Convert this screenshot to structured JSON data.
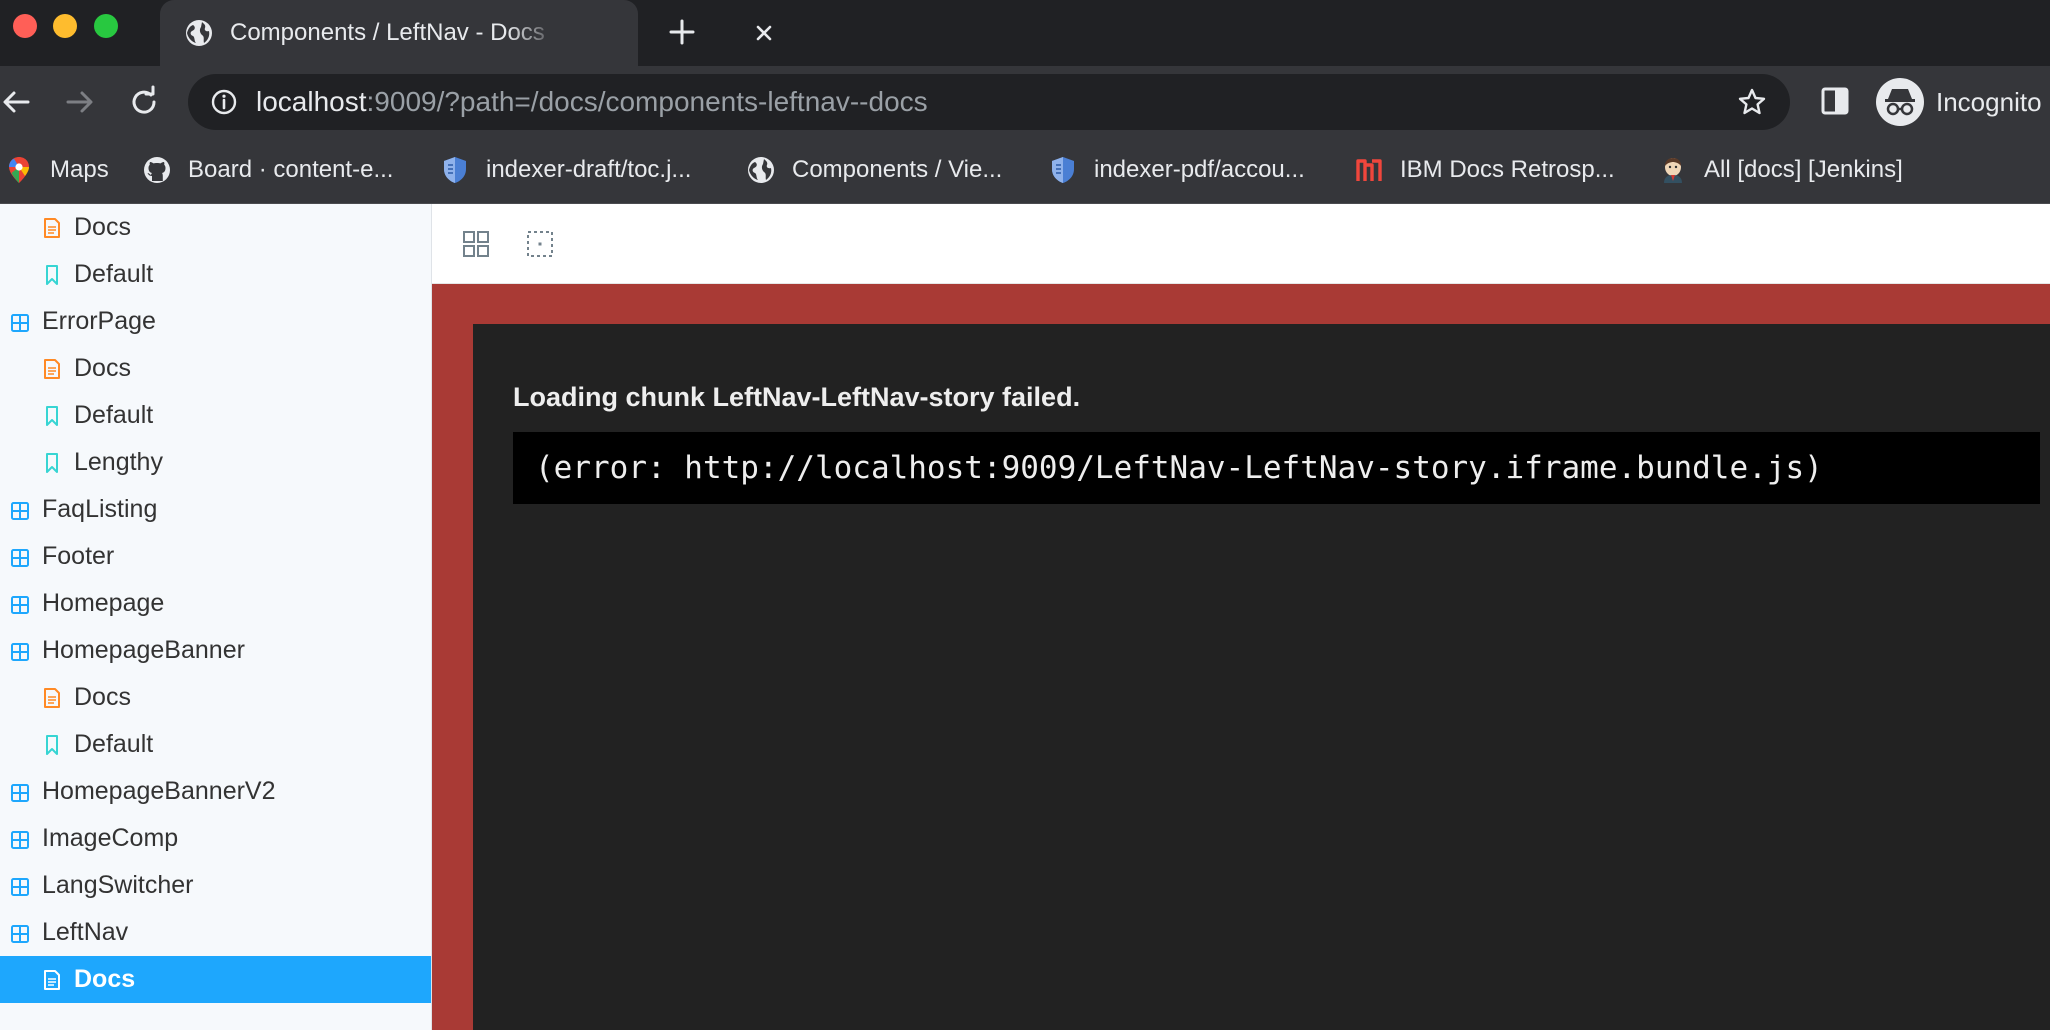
{
  "window": {
    "tab_title": "Components / LeftNav - Docs",
    "url_host": "localhost",
    "url_rest": ":9009/?path=/docs/components-leftnav--docs",
    "profile_label": "Incognito"
  },
  "bookmarks": [
    {
      "label": "Maps",
      "icon": "maps-icon"
    },
    {
      "label": "Board · content-e...",
      "icon": "github-icon"
    },
    {
      "label": "indexer-draft/toc.j...",
      "icon": "shield-bookmark-icon"
    },
    {
      "label": "Components / Vie...",
      "icon": "globe-icon"
    },
    {
      "label": "indexer-pdf/accou...",
      "icon": "shield-bookmark-icon"
    },
    {
      "label": "IBM Docs Retrosp...",
      "icon": "retro-logo-icon"
    },
    {
      "label": "All [docs] [Jenkins]",
      "icon": "jenkins-icon"
    }
  ],
  "sidebar": {
    "items": [
      {
        "label": "Docs",
        "kind": "docs",
        "selected": false
      },
      {
        "label": "Default",
        "kind": "story",
        "selected": false
      },
      {
        "label": "ErrorPage",
        "kind": "component",
        "selected": false
      },
      {
        "label": "Docs",
        "kind": "docs",
        "selected": false
      },
      {
        "label": "Default",
        "kind": "story",
        "selected": false
      },
      {
        "label": "Lengthy",
        "kind": "story",
        "selected": false
      },
      {
        "label": "FaqListing",
        "kind": "component",
        "selected": false
      },
      {
        "label": "Footer",
        "kind": "component",
        "selected": false
      },
      {
        "label": "Homepage",
        "kind": "component",
        "selected": false
      },
      {
        "label": "HomepageBanner",
        "kind": "component",
        "selected": false
      },
      {
        "label": "Docs",
        "kind": "docs",
        "selected": false
      },
      {
        "label": "Default",
        "kind": "story",
        "selected": false
      },
      {
        "label": "HomepageBannerV2",
        "kind": "component",
        "selected": false
      },
      {
        "label": "ImageComp",
        "kind": "component",
        "selected": false
      },
      {
        "label": "LangSwitcher",
        "kind": "component",
        "selected": false
      },
      {
        "label": "LeftNav",
        "kind": "component",
        "selected": false
      },
      {
        "label": "Docs",
        "kind": "docs",
        "selected": true
      }
    ]
  },
  "preview": {
    "error_title": "Loading chunk LeftNav-LeftNav-story failed.",
    "error_detail": "(error: http://localhost:9009/LeftNav-LeftNav-story.iframe.bundle.js)"
  },
  "colors": {
    "sidebar_bg": "#f6f9fc",
    "selected_bg": "#1ea7fd",
    "error_bg": "#a93a35",
    "docs_icon": "#ff8a25",
    "story_icon": "#37d5d3",
    "component_icon": "#1ea7fd"
  }
}
